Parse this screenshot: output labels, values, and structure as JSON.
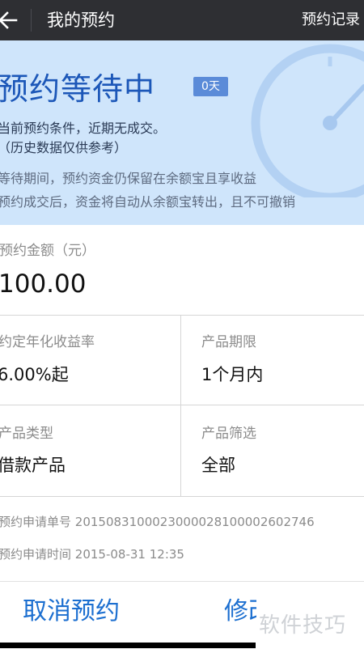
{
  "header": {
    "title": "我的预约",
    "records_label": "预约记录"
  },
  "banner": {
    "status_title": "预约等待中",
    "badge": "0天",
    "condition_line": "当前预约条件，近期无成交。",
    "history_note": "（历史数据仅供参考）",
    "note_1": "等待期间，预约资金仍保留在余额宝且享收益",
    "note_2": "预约成交后，资金将自动从余额宝转出，且不可撤销"
  },
  "amount": {
    "label": "预约金额（元）",
    "value": "100.00"
  },
  "details": {
    "yield_label": "约定年化收益率",
    "yield_value": "6.00%起",
    "term_label": "产品期限",
    "term_value": "1个月内",
    "type_label": "产品类型",
    "type_value": "借款产品",
    "filter_label": "产品筛选",
    "filter_value": "全部"
  },
  "order": {
    "number_label": "预约申请单号",
    "number_value": "2015083100023000028100002602746",
    "time_label": "预约申请时间",
    "time_value": "2015-08-31 12:35"
  },
  "actions": {
    "cancel_label": "取消预约",
    "modify_label": "修改预约"
  },
  "watermark": "软件技巧",
  "colors": {
    "topbar": "#2e2f33",
    "banner": "#cfe5fb",
    "accent_blue": "#1c57b8",
    "button_blue": "#1c6fd0",
    "badge": "#5b8bd8"
  },
  "icons": {
    "back": "arrow-left-icon",
    "clock": "clock-icon"
  }
}
